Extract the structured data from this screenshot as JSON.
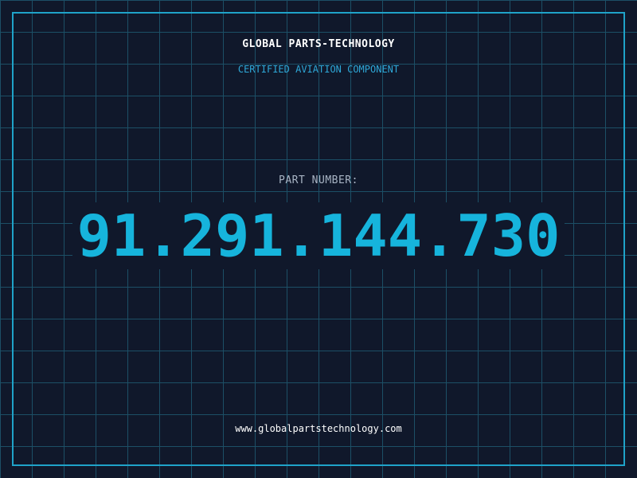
{
  "header": {
    "company_name": "GLOBAL PARTS-TECHNOLOGY",
    "tagline": "CERTIFIED AVIATION COMPONENT"
  },
  "main": {
    "part_number_label": "PART NUMBER:",
    "part_number": "91.291.144.730"
  },
  "footer": {
    "website": "www.globalpartstechnology.com"
  },
  "colors": {
    "background": "#10182b",
    "grid": "#1c4f66",
    "accent": "#1fa3c9",
    "part_number": "#16b4dc",
    "label": "#a8b4c4",
    "text": "#ffffff"
  }
}
